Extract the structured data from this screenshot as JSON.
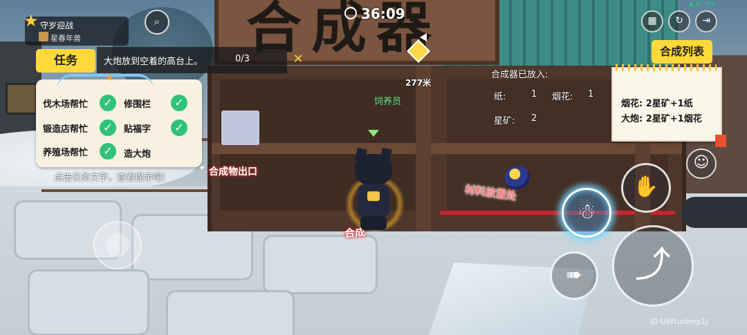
{
  "event_card": {
    "title": "守岁迎战",
    "subtitle": "星春年兽",
    "star_icon": "star-icon",
    "avatar_icon": "nian-beast-icon"
  },
  "scan_icon": "search-icon",
  "timer": {
    "icon": "stopwatch-icon",
    "value": "36:09"
  },
  "signal": {
    "value": "67 ms",
    "color": "#1fd37a",
    "icon": "wifi-icon"
  },
  "top_right_icons": [
    "grid-menu-icon",
    "refresh-icon",
    "exit-door-icon"
  ],
  "task": {
    "tab_label": "任务",
    "description": "大炮放到空着的高台上。",
    "progress": "0/3",
    "close_icon": "close-icon",
    "items": [
      {
        "label": "伐木场帮忙",
        "done": true
      },
      {
        "label": "修围栏",
        "done": true
      },
      {
        "label": "锻造店帮忙",
        "done": true
      },
      {
        "label": "贴福字",
        "done": true
      },
      {
        "label": "养殖场帮忙",
        "done": true
      },
      {
        "label": "造大炮",
        "done": false
      }
    ],
    "hint": "点击任务文字，查看提示吧!"
  },
  "scene_labels": {
    "output": "合成物出口",
    "material_area": "材料放置处",
    "synthesize": "合成",
    "npc_name": "饲养员",
    "distance": "277米",
    "sign_text": "合成器"
  },
  "composer": {
    "title": "合成器已放入:",
    "paper_label": "纸:",
    "paper_count": "1",
    "firework_label": "烟花:",
    "firework_count": "1",
    "starore_label": "星矿:",
    "starore_count": "2"
  },
  "recipe": {
    "button_label": "合成列表",
    "lines": [
      "烟花: 2星矿+1纸",
      "大炮: 2星矿+1烟花"
    ]
  },
  "actions": {
    "emote_icon": "smiley-icon",
    "throw_icon": "throw-icon",
    "interact_icon": "interact-icon",
    "jump_icon": "jump-icon",
    "slide_icon": "slide-icon"
  },
  "uid": "ID:UWtunImp1J",
  "colors": {
    "accent_yellow": "#ffd93a",
    "check_green": "#30c27a",
    "decal_red": "#e64a52",
    "npc_green": "#6ee07c"
  }
}
